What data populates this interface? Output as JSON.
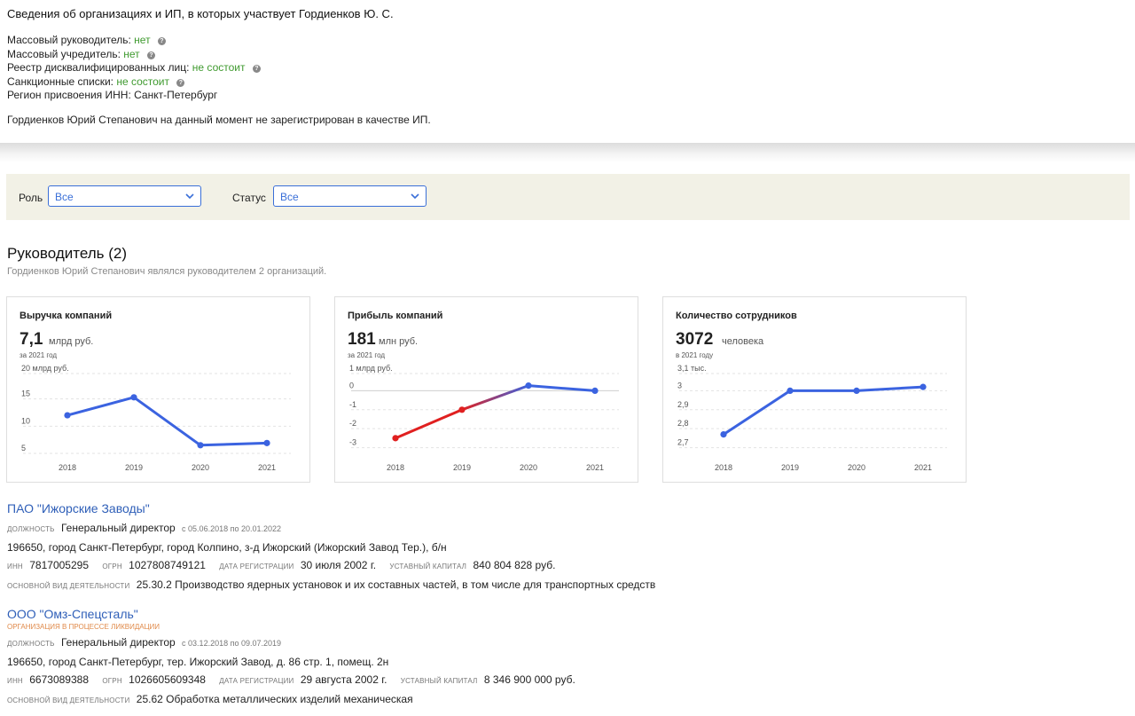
{
  "header": {
    "title": "Сведения об организациях и ИП, в которых участвует Гордиенков Ю. С.",
    "mass_director_label": "Массовый руководитель:",
    "mass_director_value": "нет",
    "mass_founder_label": "Массовый учредитель:",
    "mass_founder_value": "нет",
    "disq_label": "Реестр дисквалифицированных лиц:",
    "disq_value": "не состоит",
    "sanctions_label": "Санкционные списки:",
    "sanctions_value": "не состоит",
    "region_label": "Регион присвоения ИНН:",
    "region_value": "Санкт-Петербург",
    "note": "Гордиенков Юрий Степанович на данный момент не зарегистрирован в качестве ИП."
  },
  "filters": {
    "role_label": "Роль",
    "role_value": "Все",
    "status_label": "Статус",
    "status_value": "Все"
  },
  "section": {
    "title": "Руководитель (2)",
    "subtitle": "Гордиенков Юрий Степанович являлся руководителем 2 организаций."
  },
  "colors": {
    "line": "#3b63e0",
    "negative": "#e02020",
    "link": "#2f5fb8",
    "green": "#3f9a2f"
  },
  "chart_data": [
    {
      "type": "line",
      "title": "Выручка компаний",
      "big_value": "7,1",
      "unit": "млрд руб.",
      "period": "за 2021 год",
      "top_label": "20 млрд руб.",
      "ytick_labels": [
        "15",
        "10",
        "5"
      ],
      "yticks": [
        15,
        10,
        5
      ],
      "categories": [
        "2018",
        "2019",
        "2020",
        "2021"
      ],
      "values": [
        12.0,
        15.3,
        6.5,
        6.9
      ],
      "ylim": [
        5,
        20
      ]
    },
    {
      "type": "line",
      "title": "Прибыль компаний",
      "big_value": "181",
      "unit": "млн руб.",
      "period": "за 2021 год",
      "top_label": "1 млрд руб.",
      "ytick_labels": [
        "0",
        "-1",
        "-2",
        "-3"
      ],
      "yticks": [
        0,
        -1,
        -2,
        -3
      ],
      "categories": [
        "2018",
        "2019",
        "2020",
        "2021"
      ],
      "values": [
        -2.5,
        -1.0,
        0.27,
        0.0
      ],
      "ylim": [
        -3.3,
        1
      ]
    },
    {
      "type": "line",
      "title": "Количество сотрудников",
      "big_value": "3072",
      "unit": "человека",
      "period": "в 2021 году",
      "top_label": "3,1 тыс.",
      "ytick_labels": [
        "3",
        "2,9",
        "2,8",
        "2,7"
      ],
      "yticks": [
        3.0,
        2.9,
        2.8,
        2.7
      ],
      "categories": [
        "2018",
        "2019",
        "2020",
        "2021"
      ],
      "values": [
        2.77,
        3.0,
        3.0,
        3.02
      ],
      "ylim": [
        2.67,
        3.1
      ]
    }
  ],
  "orgs": [
    {
      "name": "ПАО \"Ижорские Заводы\"",
      "status": "",
      "position_label": "должность",
      "position": "Генеральный директор",
      "dates": "с 05.06.2018 по 20.01.2022",
      "address": "196650, город Санкт-Петербург, город Колпино, з-д Ижорский (Ижорский Завод Тер.), б/н",
      "inn_label": "ИНН",
      "inn": "7817005295",
      "ogrn_label": "ОГРН",
      "ogrn": "1027808749121",
      "reg_label": "дата регистрации",
      "reg_date": "30 июля 2002 г.",
      "capital_label": "уставный капитал",
      "capital": "840 804 828 руб.",
      "activity_label": "основной вид деятельности",
      "activity": "25.30.2 Производство ядерных установок и их составных частей, в том числе для транспортных средств"
    },
    {
      "name": "ООО \"Омз-Спецсталь\"",
      "status": "организация в процессе ликвидации",
      "position_label": "должность",
      "position": "Генеральный директор",
      "dates": "с 03.12.2018 по 09.07.2019",
      "address": "196650, город Санкт-Петербург, тер. Ижорский Завод, д. 86 стр. 1, помещ. 2н",
      "inn_label": "ИНН",
      "inn": "6673089388",
      "ogrn_label": "ОГРН",
      "ogrn": "1026605609348",
      "reg_label": "дата регистрации",
      "reg_date": "29 августа 2002 г.",
      "capital_label": "уставный капитал",
      "capital": "8 346 900 000 руб.",
      "activity_label": "основной вид деятельности",
      "activity": "25.62 Обработка металлических изделий механическая"
    }
  ]
}
